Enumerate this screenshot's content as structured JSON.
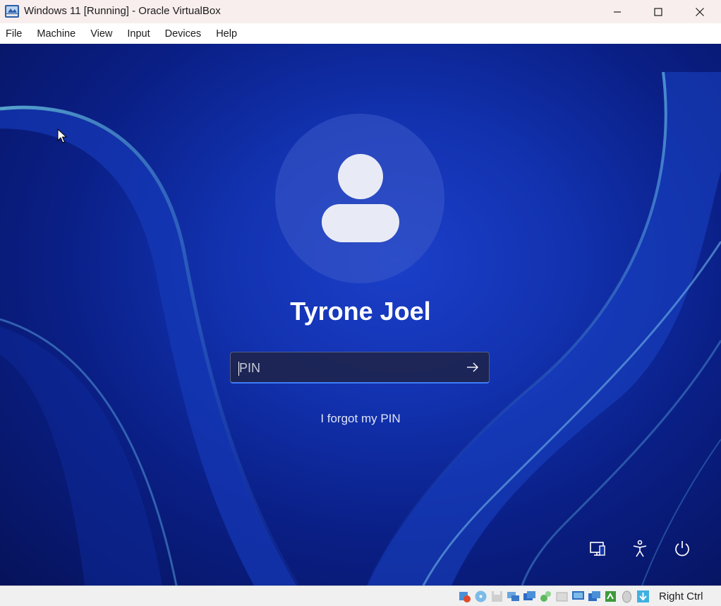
{
  "window": {
    "title": "Windows 11 [Running] - Oracle VirtualBox",
    "controls": [
      "minimize",
      "maximize",
      "close"
    ]
  },
  "menu": {
    "items": [
      "File",
      "Machine",
      "View",
      "Input",
      "Devices",
      "Help"
    ]
  },
  "login": {
    "username": "Tyrone Joel",
    "pin_placeholder": "PIN",
    "forgot_pin": "I forgot my PIN"
  },
  "corner_icons": [
    "network-icon",
    "accessibility-icon",
    "power-icon"
  ],
  "statusbar": {
    "icons": [
      "audio-icon",
      "optical-drive-icon",
      "floppy-icon",
      "network-adapters-icon",
      "shared-folders-icon",
      "usb-icon",
      "hard-disk-icon",
      "display-icon",
      "recording-icon",
      "cpu-icon",
      "mouse-integration-icon",
      "keyboard-icon"
    ],
    "host_key": "Right Ctrl"
  },
  "colors": {
    "accent": "#3d7df7",
    "wallpaper_primary": "#1232b0",
    "wallpaper_dark": "#06125a"
  }
}
